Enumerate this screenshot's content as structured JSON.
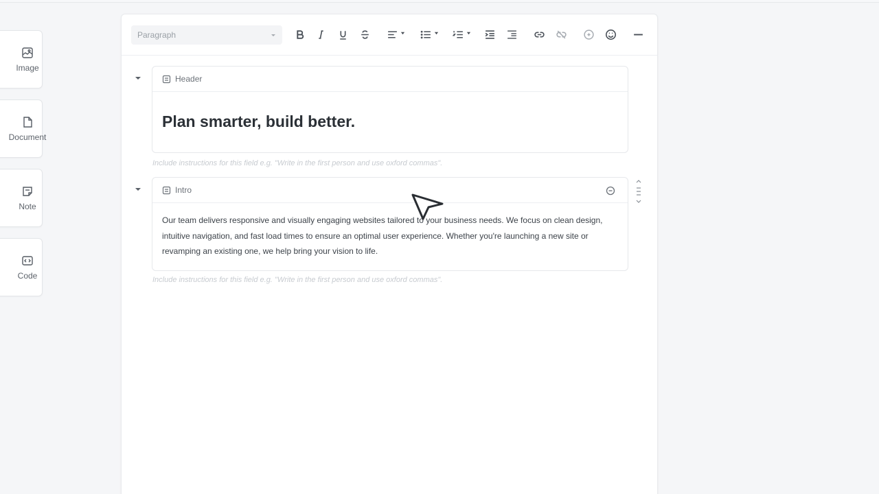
{
  "palette": {
    "blocks": [
      {
        "label": "Image",
        "icon": "image-icon"
      },
      {
        "label": "Document",
        "icon": "document-icon"
      },
      {
        "label": "Note",
        "icon": "note-icon"
      },
      {
        "label": "Code",
        "icon": "code-icon"
      }
    ]
  },
  "toolbar": {
    "paragraph_select": "Paragraph"
  },
  "fields": [
    {
      "title": "Header",
      "content": "Plan smarter, build better.",
      "instructions_placeholder": "Include instructions for this field e.g. \"Write in the first person and use oxford commas\"."
    },
    {
      "title": "Intro",
      "content": "Our team delivers responsive and visually engaging websites tailored to your business needs. We focus on clean design, intuitive navigation, and fast load times to ensure an optimal user experience. Whether you're launching a new site or revamping an existing one, we help bring your vision to life.",
      "instructions_placeholder": "Include instructions for this field e.g. \"Write in the first person and use oxford commas\"."
    }
  ]
}
